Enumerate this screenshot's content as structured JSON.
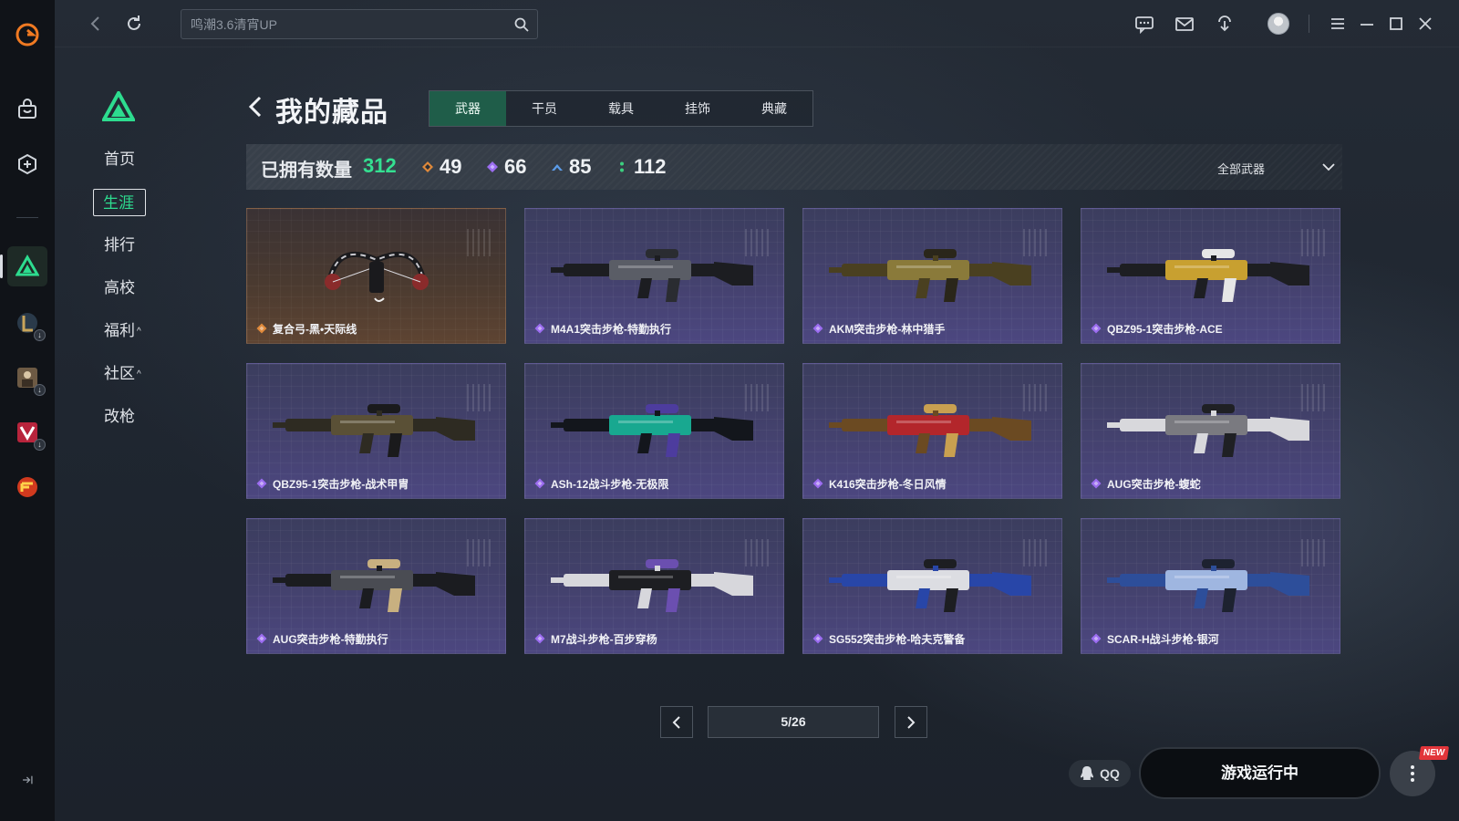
{
  "search": {
    "placeholder": "鸣潮3.6清宵UP"
  },
  "sections": {
    "items": [
      {
        "label": "首页"
      },
      {
        "label": "生涯"
      },
      {
        "label": "排行"
      },
      {
        "label": "高校"
      },
      {
        "label": "福利",
        "caret": "^"
      },
      {
        "label": "社区",
        "caret": "^"
      },
      {
        "label": "改枪"
      }
    ]
  },
  "page": {
    "title": "我的藏品",
    "tabs": [
      "武器",
      "干员",
      "载具",
      "挂饰",
      "典藏"
    ],
    "active_tab": "武器"
  },
  "stats": {
    "owned_label": "已拥有数量",
    "owned_total": "312",
    "tiers": [
      {
        "icon": "orange-diamond-icon",
        "count": "49",
        "color": "#e0893a"
      },
      {
        "icon": "purple-diamond-icon",
        "count": "66",
        "color": "#9b6cf0"
      },
      {
        "icon": "blue-chevron-icon",
        "count": "85",
        "color": "#5b9be8"
      },
      {
        "icon": "green-dots-icon",
        "count": "112",
        "color": "#3cd07f"
      }
    ],
    "filter": "全部武器"
  },
  "weapons": [
    {
      "name": "复合弓-黑•天际线",
      "rarity": "orange"
    },
    {
      "name": "M4A1突击步枪-特勤执行",
      "rarity": "purple"
    },
    {
      "name": "AKM突击步枪-林中猎手",
      "rarity": "purple"
    },
    {
      "name": "QBZ95-1突击步枪-ACE",
      "rarity": "purple"
    },
    {
      "name": "QBZ95-1突击步枪-战术甲胄",
      "rarity": "purple"
    },
    {
      "name": "ASh-12战斗步枪-无极限",
      "rarity": "purple"
    },
    {
      "name": "K416突击步枪-冬日风情",
      "rarity": "purple"
    },
    {
      "name": "AUG突击步枪-蝮蛇",
      "rarity": "purple"
    },
    {
      "name": "AUG突击步枪-特勤执行",
      "rarity": "purple"
    },
    {
      "name": "M7战斗步枪-百步穿杨",
      "rarity": "purple"
    },
    {
      "name": "SG552突击步枪-哈夫克警备",
      "rarity": "purple"
    },
    {
      "name": "SCAR-H战斗步枪-银河",
      "rarity": "purple"
    }
  ],
  "pagination": {
    "indicator": "5/26"
  },
  "footer": {
    "qq_label": "QQ",
    "run_label": "游戏运行中",
    "new_badge": "NEW"
  },
  "colors": {
    "accent": "#2ddc8f",
    "rarity_orange": "#e0893a",
    "rarity_purple": "#9b6cf0"
  }
}
